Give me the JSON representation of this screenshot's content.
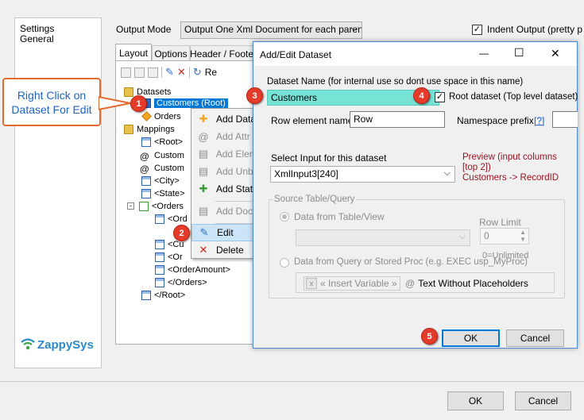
{
  "sidebar": {
    "items": [
      "Settings",
      "General"
    ]
  },
  "output": {
    "mode_label": "Output Mode",
    "mode_value": "Output One Xml Document for each parent",
    "indent_label": "Indent Output (pretty p",
    "indent_checked": "✓"
  },
  "tabs": [
    "Layout",
    "Options",
    "Header / Footer"
  ],
  "toolbar": {
    "refresh_label": "Re"
  },
  "tree": {
    "datasets_label": "Datasets",
    "customers_root": "Customers (Root)",
    "orders": "Orders",
    "mappings_label": "Mappings",
    "items": [
      "<Root>",
      "Custom",
      "Custom",
      "<City>",
      "<State>",
      "<Orders",
      "<Ord",
      "<Cu",
      "<Or",
      "<OrderAmount>",
      "</Orders>",
      "</Root>"
    ]
  },
  "callout": {
    "text": "Right Click on Dataset For Edit"
  },
  "context_menu": {
    "items": [
      {
        "label": "Add Data",
        "disabled": false
      },
      {
        "label": "Add Attr",
        "disabled": true
      },
      {
        "label": "Add Elem",
        "disabled": true
      },
      {
        "label": "Add Unb",
        "disabled": true
      },
      {
        "label": "Add Stati",
        "disabled": false
      },
      {
        "label": "Add Doc",
        "disabled": true
      },
      {
        "label": "Edit",
        "disabled": false
      },
      {
        "label": "Delete",
        "disabled": false
      }
    ]
  },
  "badges": [
    "1",
    "2",
    "3",
    "4",
    "5"
  ],
  "dialog": {
    "title": "Add/Edit Dataset",
    "controls": {
      "minimize": "—",
      "maximize": "☐",
      "close": "✕"
    },
    "dataset_name_label": "Dataset Name (for internal use so dont use space in this name)",
    "dataset_name_value": "Customers",
    "root_dataset_label": "Root dataset (Top level dataset)",
    "root_dataset_checked": "✓",
    "row_element_label": "Row element name",
    "row_element_value": "Row",
    "namespace_label": "Namespace prefix",
    "namespace_help": "[?]",
    "select_input_label": "Select Input for this dataset",
    "select_input_value": "XmlInput3[240]",
    "preview_text": "Preview (input columns [top 2])",
    "preview_mapping": "Customers -> RecordID",
    "source_group_label": "Source Table/Query",
    "radio_table_label": "Data from Table/View",
    "row_limit_label": "Row Limit",
    "row_limit_value": "0",
    "row_limit_hint": "0=Unlimited",
    "radio_query_label": "Data from Query or Stored Proc (e.g. EXEC usp_MyProc)",
    "insert_variable_label": "« Insert Variable »",
    "text_without_placeholders_label": "Text Without Placeholders",
    "ok_label": "OK",
    "cancel_label": "Cancel"
  },
  "footer": {
    "ok_label": "OK",
    "cancel_label": "Cancel"
  },
  "brand": {
    "name": "ZappySys"
  },
  "colors": {
    "accent": "#0078d7",
    "badge": "#e63b2a",
    "callout_border": "#e36b2f",
    "callout_text": "#1f63c6",
    "highlight": "#76e3d6",
    "preview_text": "#9b0f1e",
    "selection": "#0078d7"
  }
}
